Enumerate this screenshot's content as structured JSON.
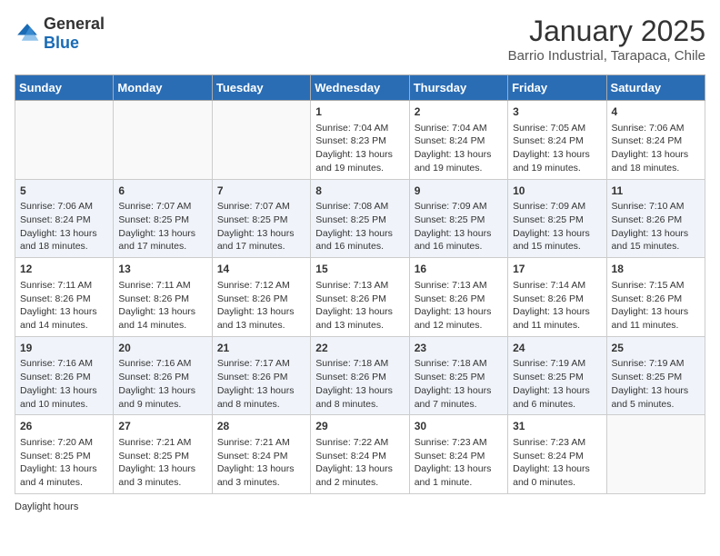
{
  "header": {
    "logo_general": "General",
    "logo_blue": "Blue",
    "month": "January 2025",
    "location": "Barrio Industrial, Tarapaca, Chile"
  },
  "calendar": {
    "days_of_week": [
      "Sunday",
      "Monday",
      "Tuesday",
      "Wednesday",
      "Thursday",
      "Friday",
      "Saturday"
    ],
    "weeks": [
      [
        {
          "num": "",
          "content": ""
        },
        {
          "num": "",
          "content": ""
        },
        {
          "num": "",
          "content": ""
        },
        {
          "num": "1",
          "content": "Sunrise: 7:04 AM\nSunset: 8:23 PM\nDaylight: 13 hours and 19 minutes."
        },
        {
          "num": "2",
          "content": "Sunrise: 7:04 AM\nSunset: 8:24 PM\nDaylight: 13 hours and 19 minutes."
        },
        {
          "num": "3",
          "content": "Sunrise: 7:05 AM\nSunset: 8:24 PM\nDaylight: 13 hours and 19 minutes."
        },
        {
          "num": "4",
          "content": "Sunrise: 7:06 AM\nSunset: 8:24 PM\nDaylight: 13 hours and 18 minutes."
        }
      ],
      [
        {
          "num": "5",
          "content": "Sunrise: 7:06 AM\nSunset: 8:24 PM\nDaylight: 13 hours and 18 minutes."
        },
        {
          "num": "6",
          "content": "Sunrise: 7:07 AM\nSunset: 8:25 PM\nDaylight: 13 hours and 17 minutes."
        },
        {
          "num": "7",
          "content": "Sunrise: 7:07 AM\nSunset: 8:25 PM\nDaylight: 13 hours and 17 minutes."
        },
        {
          "num": "8",
          "content": "Sunrise: 7:08 AM\nSunset: 8:25 PM\nDaylight: 13 hours and 16 minutes."
        },
        {
          "num": "9",
          "content": "Sunrise: 7:09 AM\nSunset: 8:25 PM\nDaylight: 13 hours and 16 minutes."
        },
        {
          "num": "10",
          "content": "Sunrise: 7:09 AM\nSunset: 8:25 PM\nDaylight: 13 hours and 15 minutes."
        },
        {
          "num": "11",
          "content": "Sunrise: 7:10 AM\nSunset: 8:26 PM\nDaylight: 13 hours and 15 minutes."
        }
      ],
      [
        {
          "num": "12",
          "content": "Sunrise: 7:11 AM\nSunset: 8:26 PM\nDaylight: 13 hours and 14 minutes."
        },
        {
          "num": "13",
          "content": "Sunrise: 7:11 AM\nSunset: 8:26 PM\nDaylight: 13 hours and 14 minutes."
        },
        {
          "num": "14",
          "content": "Sunrise: 7:12 AM\nSunset: 8:26 PM\nDaylight: 13 hours and 13 minutes."
        },
        {
          "num": "15",
          "content": "Sunrise: 7:13 AM\nSunset: 8:26 PM\nDaylight: 13 hours and 13 minutes."
        },
        {
          "num": "16",
          "content": "Sunrise: 7:13 AM\nSunset: 8:26 PM\nDaylight: 13 hours and 12 minutes."
        },
        {
          "num": "17",
          "content": "Sunrise: 7:14 AM\nSunset: 8:26 PM\nDaylight: 13 hours and 11 minutes."
        },
        {
          "num": "18",
          "content": "Sunrise: 7:15 AM\nSunset: 8:26 PM\nDaylight: 13 hours and 11 minutes."
        }
      ],
      [
        {
          "num": "19",
          "content": "Sunrise: 7:16 AM\nSunset: 8:26 PM\nDaylight: 13 hours and 10 minutes."
        },
        {
          "num": "20",
          "content": "Sunrise: 7:16 AM\nSunset: 8:26 PM\nDaylight: 13 hours and 9 minutes."
        },
        {
          "num": "21",
          "content": "Sunrise: 7:17 AM\nSunset: 8:26 PM\nDaylight: 13 hours and 8 minutes."
        },
        {
          "num": "22",
          "content": "Sunrise: 7:18 AM\nSunset: 8:26 PM\nDaylight: 13 hours and 8 minutes."
        },
        {
          "num": "23",
          "content": "Sunrise: 7:18 AM\nSunset: 8:25 PM\nDaylight: 13 hours and 7 minutes."
        },
        {
          "num": "24",
          "content": "Sunrise: 7:19 AM\nSunset: 8:25 PM\nDaylight: 13 hours and 6 minutes."
        },
        {
          "num": "25",
          "content": "Sunrise: 7:19 AM\nSunset: 8:25 PM\nDaylight: 13 hours and 5 minutes."
        }
      ],
      [
        {
          "num": "26",
          "content": "Sunrise: 7:20 AM\nSunset: 8:25 PM\nDaylight: 13 hours and 4 minutes."
        },
        {
          "num": "27",
          "content": "Sunrise: 7:21 AM\nSunset: 8:25 PM\nDaylight: 13 hours and 3 minutes."
        },
        {
          "num": "28",
          "content": "Sunrise: 7:21 AM\nSunset: 8:24 PM\nDaylight: 13 hours and 3 minutes."
        },
        {
          "num": "29",
          "content": "Sunrise: 7:22 AM\nSunset: 8:24 PM\nDaylight: 13 hours and 2 minutes."
        },
        {
          "num": "30",
          "content": "Sunrise: 7:23 AM\nSunset: 8:24 PM\nDaylight: 13 hours and 1 minute."
        },
        {
          "num": "31",
          "content": "Sunrise: 7:23 AM\nSunset: 8:24 PM\nDaylight: 13 hours and 0 minutes."
        },
        {
          "num": "",
          "content": ""
        }
      ]
    ]
  },
  "footer": {
    "label": "Daylight hours"
  }
}
